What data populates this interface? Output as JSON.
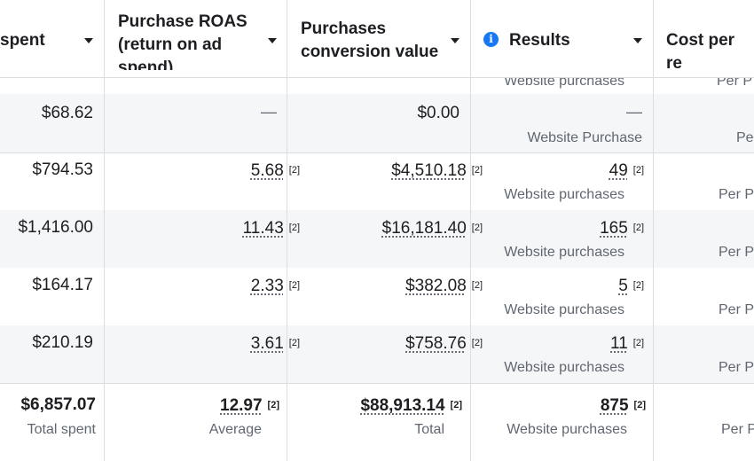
{
  "columns": {
    "spent": "spent",
    "roas": "Purchase ROAS (return on ad spend)",
    "roas_l1": "Purchase ROAS",
    "roas_l2": "(return on ad",
    "roas_l3": "spend)",
    "conv_l1": "Purchases",
    "conv_l2": "conversion value",
    "results": "Results",
    "cost": "Cost per re"
  },
  "top_partial": {
    "results_sub": "Website purchases",
    "cost_sub": "Per P"
  },
  "ref_mark": "[2]",
  "rows": [
    {
      "spent": "$68.62",
      "roas": "—",
      "conv": "$0.00",
      "results": "—",
      "results_sub": "Website Purchase",
      "cost_sub": "Pe"
    },
    {
      "spent": "$794.53",
      "roas": "5.68",
      "conv": "$4,510.18",
      "results": "49",
      "results_sub": "Website purchases",
      "cost_sub": "Per P"
    },
    {
      "spent": "$1,416.00",
      "roas": "11.43",
      "conv": "$16,181.40",
      "results": "165",
      "results_sub": "Website purchases",
      "cost_sub": "Per P"
    },
    {
      "spent": "$164.17",
      "roas": "2.33",
      "conv": "$382.08",
      "results": "5",
      "results_sub": "Website purchases",
      "cost_sub": "Per P"
    },
    {
      "spent": "$210.19",
      "roas": "3.61",
      "conv": "$758.76",
      "results": "11",
      "results_sub": "Website purchases",
      "cost_sub": "Per P"
    }
  ],
  "totals": {
    "spent": "$6,857.07",
    "spent_sub": "Total spent",
    "roas": "12.97",
    "roas_sub": "Average",
    "conv": "$88,913.14",
    "conv_sub": "Total",
    "results": "875",
    "results_sub": "Website purchases",
    "cost_sub": "Per P"
  },
  "icons": {
    "sort": "caret-down-icon",
    "info": "info-icon"
  },
  "colors": {
    "accent": "#1877f2",
    "shade": "#f5f6f7",
    "border": "#dadde1"
  }
}
